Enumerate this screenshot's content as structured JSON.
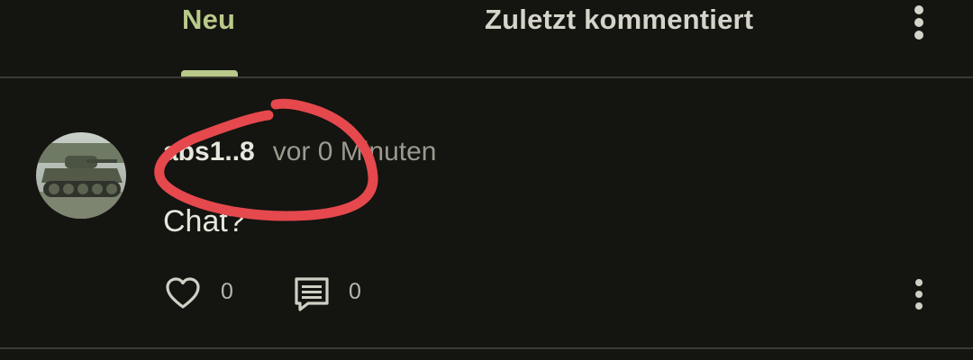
{
  "tabs": [
    {
      "label": "Neu",
      "active": true
    },
    {
      "label": "Zuletzt kommentiert",
      "active": false
    }
  ],
  "post": {
    "username": "abs1..8",
    "timestamp": "vor 0 Minuten",
    "text": "Chat?",
    "likes": "0",
    "comments": "0"
  },
  "colors": {
    "background": "#141410",
    "accent": "#b9c98a",
    "annotation": "#e5484d"
  },
  "icons": {
    "header_menu": "more-vertical-icon",
    "like": "heart-icon",
    "comment": "comment-icon",
    "post_menu": "more-vertical-icon"
  }
}
